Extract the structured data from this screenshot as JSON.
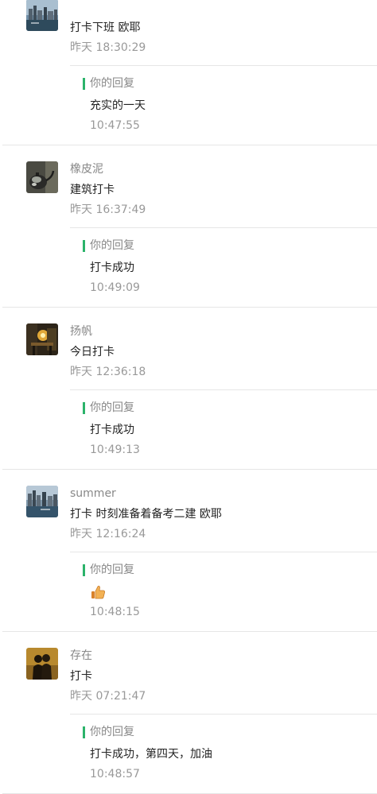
{
  "messages": [
    {
      "name": "",
      "avatar_icon": "harbor-city-avatar",
      "content": "打卡下班 欧耶",
      "time": "昨天 18:30:29",
      "reply_label": "你的回复",
      "reply_text": "充实的一天",
      "reply_time": "10:47:55"
    },
    {
      "name": "橡皮泥",
      "avatar_icon": "teapot-avatar",
      "content": "建筑打卡",
      "time": "昨天 16:37:49",
      "reply_label": "你的回复",
      "reply_text": "打卡成功",
      "reply_time": "10:49:09"
    },
    {
      "name": "扬帆",
      "avatar_icon": "cafe-night-avatar",
      "content": "今日打卡",
      "time": "昨天 12:36:18",
      "reply_label": "你的回复",
      "reply_text": "打卡成功",
      "reply_time": "10:49:13"
    },
    {
      "name": "summer",
      "avatar_icon": "harbor-city-avatar",
      "content": "打卡 时刻准备着备考二建 欧耶",
      "time": "昨天 12:16:24",
      "reply_label": "你的回复",
      "reply_text": "",
      "reply_icon": "thumbs-up-icon",
      "reply_time": "10:48:15"
    },
    {
      "name": "存在",
      "avatar_icon": "couple-silhouette-avatar",
      "content": "打卡",
      "time": "昨天 07:21:47",
      "reply_label": "你的回复",
      "reply_text": "打卡成功，第四天，加油",
      "reply_time": "10:48:57"
    }
  ],
  "colors": {
    "accent": "#2bb36a",
    "divider": "#e6e6e6",
    "muted_text": "#999999",
    "main_text": "#222222"
  }
}
